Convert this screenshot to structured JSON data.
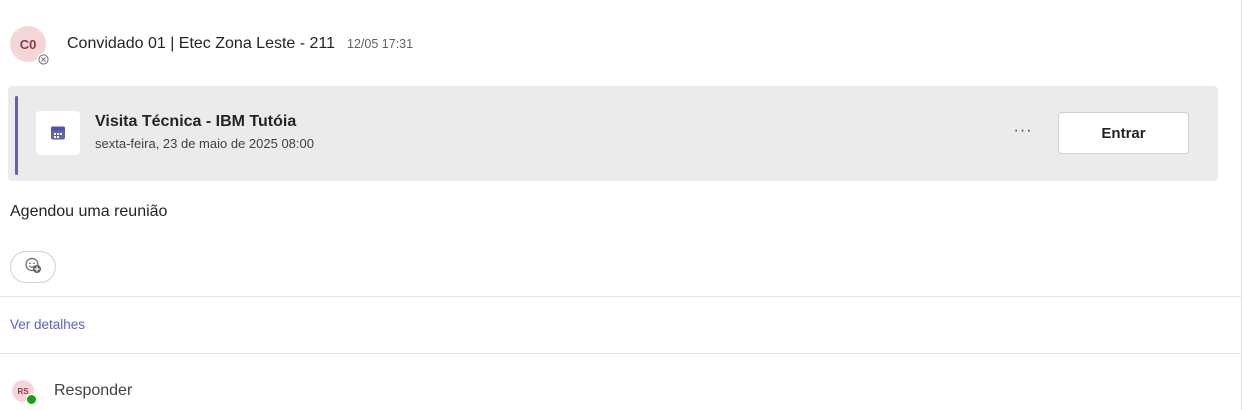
{
  "post": {
    "author_initials": "C0",
    "author": "Convidado 01 | Etec Zona Leste - 211",
    "timestamp": "12/05 17:31",
    "author_status_icon": "unknown-status-icon"
  },
  "meeting_card": {
    "icon": "calendar-icon",
    "title": "Visita Técnica - IBM Tutóia",
    "datetime": "sexta-feira, 23 de maio de 2025 08:00",
    "more_label": "···",
    "join_label": "Entrar",
    "accent_color": "#6264a7"
  },
  "message": {
    "text": "Agendou uma reunião"
  },
  "reaction": {
    "icon": "add-reaction-icon"
  },
  "details": {
    "label": "Ver detalhes",
    "color": "#5b5fc7"
  },
  "reply": {
    "avatar_initials": "RS",
    "label": "Responder",
    "presence_color": "#13a10e"
  }
}
